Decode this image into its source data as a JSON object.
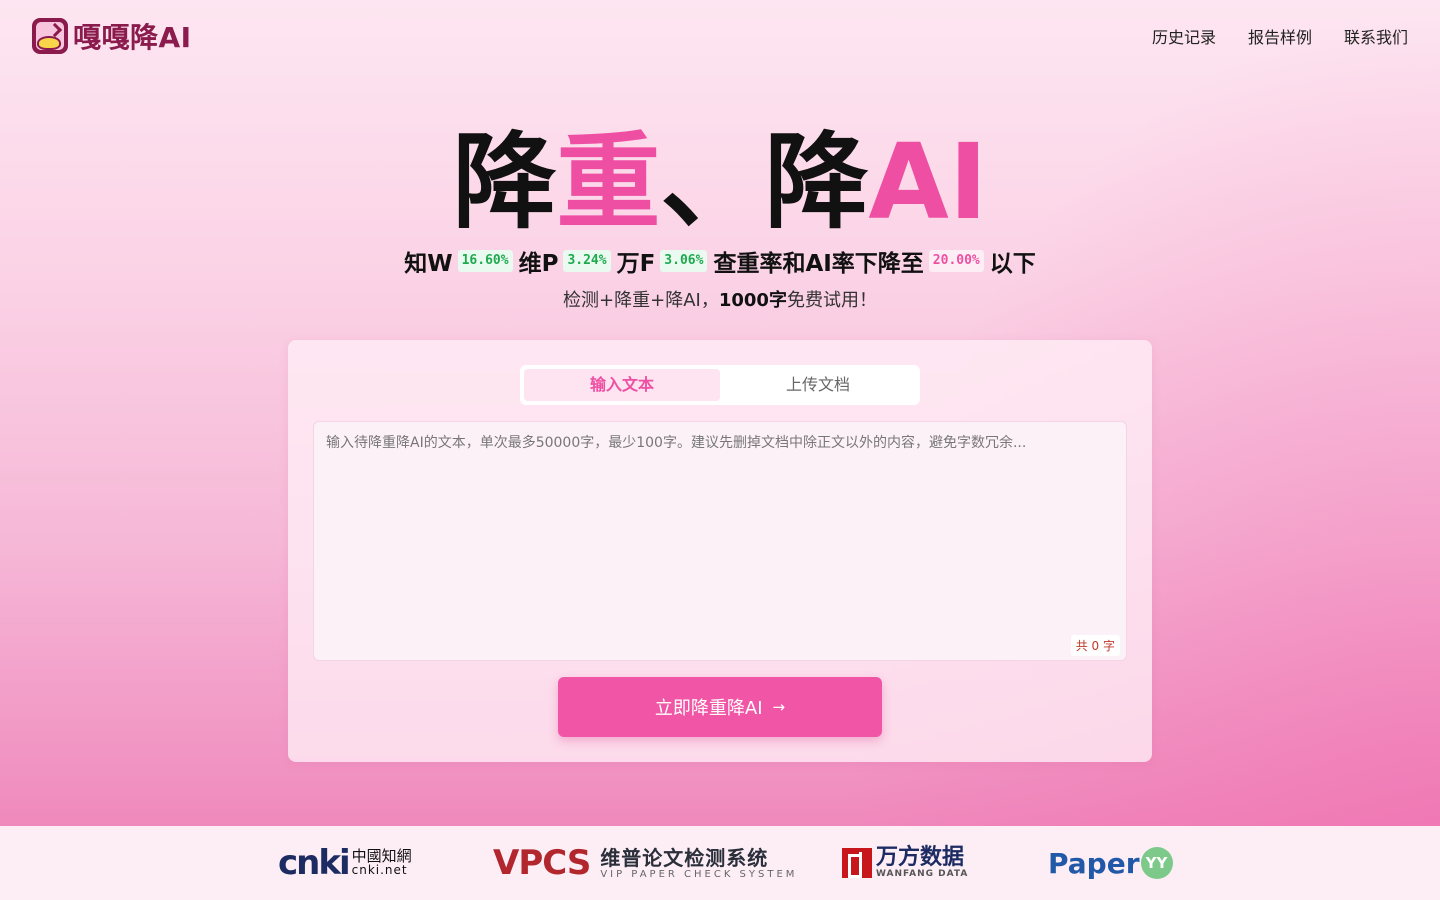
{
  "header": {
    "logo_text": "嘎嘎降AI",
    "nav": [
      "历史记录",
      "报告样例",
      "联系我们"
    ]
  },
  "hero": {
    "title_part1": "降",
    "title_part2": "重",
    "title_part3": "、降",
    "title_part4": "AI",
    "stats": [
      {
        "label": "知W",
        "value": "16.60%"
      },
      {
        "label": "维P",
        "value": "3.24%"
      },
      {
        "label": "万F",
        "value": "3.06%"
      }
    ],
    "target_label": "查重率和AI率下降至",
    "target_value": "20.00%",
    "target_suffix": "以下",
    "desc_prefix": "检测+降重+降AI，",
    "desc_bold": "1000字",
    "desc_suffix": "免费试用！"
  },
  "card": {
    "tabs": [
      "输入文本",
      "上传文档"
    ],
    "active_tab": 0,
    "input_value": "",
    "input_placeholder": "输入待降重降AI的文本，单次最多50000字，最少100字。建议先删掉文档中除正文以外的内容，避免字数冗余...",
    "counter": "共 0 字",
    "submit_label": "立即降重降AI",
    "submit_arrow": "→"
  },
  "partners": {
    "cnki_mark": "cnki",
    "cnki_cn": "中國知網",
    "cnki_en": "cnki.net",
    "vpcs_mark": "VPCS",
    "vpcs_cn": "维普论文检测系统",
    "vpcs_en": "VIP PAPER CHECK SYSTEM",
    "wanfang_cn": "万方数据",
    "wanfang_en": "WANFANG DATA",
    "paperyy_text": "Paper",
    "paperyy_badge": "YY"
  },
  "colors": {
    "accent": "#ef4fa3",
    "brand": "#8b1a4d",
    "green": "#1eaa4d"
  }
}
